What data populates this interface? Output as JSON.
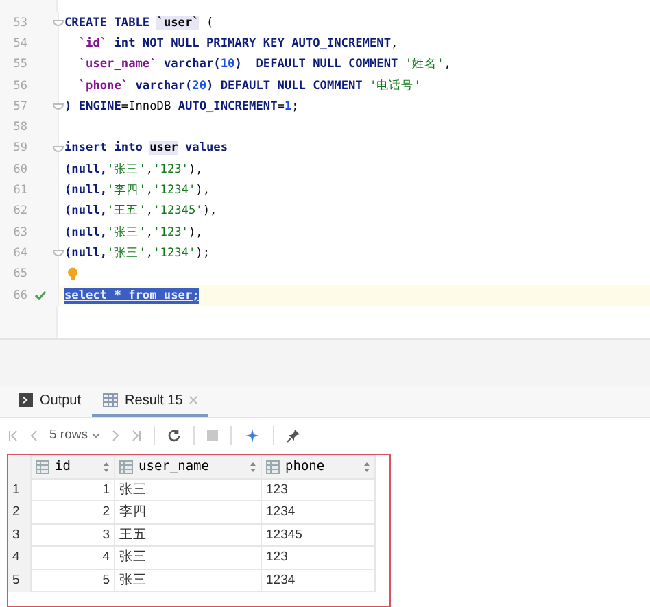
{
  "editor": {
    "lines": [
      {
        "number": "53",
        "fold": true,
        "tokens": [
          {
            "text": "CREATE TABLE ",
            "kind": "keyword"
          },
          {
            "text": "`user`",
            "kind": "ref"
          },
          {
            "text": " (",
            "kind": "plain"
          }
        ]
      },
      {
        "number": "54",
        "tokens": [
          {
            "text": "  `id`",
            "kind": "ident"
          },
          {
            "text": " int NOT NULL PRIMARY KEY AUTO_INCREMENT",
            "kind": "keyword"
          },
          {
            "text": ",",
            "kind": "plain"
          }
        ]
      },
      {
        "number": "55",
        "tokens": [
          {
            "text": "  `user_name`",
            "kind": "ident"
          },
          {
            "text": " varchar(",
            "kind": "keyword"
          },
          {
            "text": "10",
            "kind": "number"
          },
          {
            "text": ")  DEFAULT NULL COMMENT ",
            "kind": "keyword"
          },
          {
            "text": "'姓名'",
            "kind": "string"
          },
          {
            "text": ",",
            "kind": "plain"
          }
        ]
      },
      {
        "number": "56",
        "tokens": [
          {
            "text": "  `phone`",
            "kind": "ident"
          },
          {
            "text": " varchar(",
            "kind": "keyword"
          },
          {
            "text": "20",
            "kind": "number"
          },
          {
            "text": ") DEFAULT NULL COMMENT ",
            "kind": "keyword"
          },
          {
            "text": "'电话号'",
            "kind": "string"
          }
        ]
      },
      {
        "number": "57",
        "fold": true,
        "tokens": [
          {
            "text": ") ENGINE",
            "kind": "keyword"
          },
          {
            "text": "=InnoDB ",
            "kind": "plain"
          },
          {
            "text": "AUTO_INCREMENT",
            "kind": "keyword"
          },
          {
            "text": "=",
            "kind": "plain"
          },
          {
            "text": "1",
            "kind": "number"
          },
          {
            "text": ";",
            "kind": "plain"
          }
        ]
      },
      {
        "number": "58"
      },
      {
        "number": "59",
        "fold": true,
        "tokens": [
          {
            "text": "insert into ",
            "kind": "keyword"
          },
          {
            "text": "user",
            "kind": "ref"
          },
          {
            "text": " values",
            "kind": "keyword"
          }
        ]
      },
      {
        "number": "60",
        "tokens": [
          {
            "text": "(null,",
            "kind": "keyword"
          },
          {
            "text": "'张三'",
            "kind": "string"
          },
          {
            "text": ",",
            "kind": "plain"
          },
          {
            "text": "'123'",
            "kind": "string"
          },
          {
            "text": "),",
            "kind": "plain"
          }
        ]
      },
      {
        "number": "61",
        "tokens": [
          {
            "text": "(null,",
            "kind": "keyword"
          },
          {
            "text": "'李四'",
            "kind": "string"
          },
          {
            "text": ",",
            "kind": "plain"
          },
          {
            "text": "'1234'",
            "kind": "string"
          },
          {
            "text": "),",
            "kind": "plain"
          }
        ]
      },
      {
        "number": "62",
        "tokens": [
          {
            "text": "(null,",
            "kind": "keyword"
          },
          {
            "text": "'王五'",
            "kind": "string"
          },
          {
            "text": ",",
            "kind": "plain"
          },
          {
            "text": "'12345'",
            "kind": "string"
          },
          {
            "text": "),",
            "kind": "plain"
          }
        ]
      },
      {
        "number": "63",
        "tokens": [
          {
            "text": "(null,",
            "kind": "keyword"
          },
          {
            "text": "'张三'",
            "kind": "string"
          },
          {
            "text": ",",
            "kind": "plain"
          },
          {
            "text": "'123'",
            "kind": "string"
          },
          {
            "text": "),",
            "kind": "plain"
          }
        ]
      },
      {
        "number": "64",
        "fold": true,
        "tokens": [
          {
            "text": "(null,",
            "kind": "keyword"
          },
          {
            "text": "'张三'",
            "kind": "string"
          },
          {
            "text": ",",
            "kind": "plain"
          },
          {
            "text": "'1234'",
            "kind": "string"
          },
          {
            "text": ");",
            "kind": "plain"
          }
        ]
      },
      {
        "number": "65",
        "bulb": true
      },
      {
        "number": "66",
        "current": true,
        "executed": true,
        "selected": true,
        "tokens": [
          {
            "text": "select * from user;",
            "kind": "keyword"
          }
        ]
      }
    ]
  },
  "tabs": [
    {
      "label": "Output",
      "kind": "output",
      "selected": false
    },
    {
      "label": "Result 15",
      "kind": "result",
      "selected": true,
      "closable": true
    }
  ],
  "toolbar": {
    "rows_label": "5 rows"
  },
  "table": {
    "columns": [
      "id",
      "user_name",
      "phone"
    ],
    "rows": [
      {
        "number": "1",
        "cells": [
          "1",
          "张三",
          "123"
        ]
      },
      {
        "number": "2",
        "cells": [
          "2",
          "李四",
          "1234"
        ]
      },
      {
        "number": "3",
        "cells": [
          "3",
          "王五",
          "12345"
        ]
      },
      {
        "number": "4",
        "cells": [
          "4",
          "张三",
          "123"
        ]
      },
      {
        "number": "5",
        "cells": [
          "5",
          "张三",
          "1234"
        ]
      }
    ]
  }
}
